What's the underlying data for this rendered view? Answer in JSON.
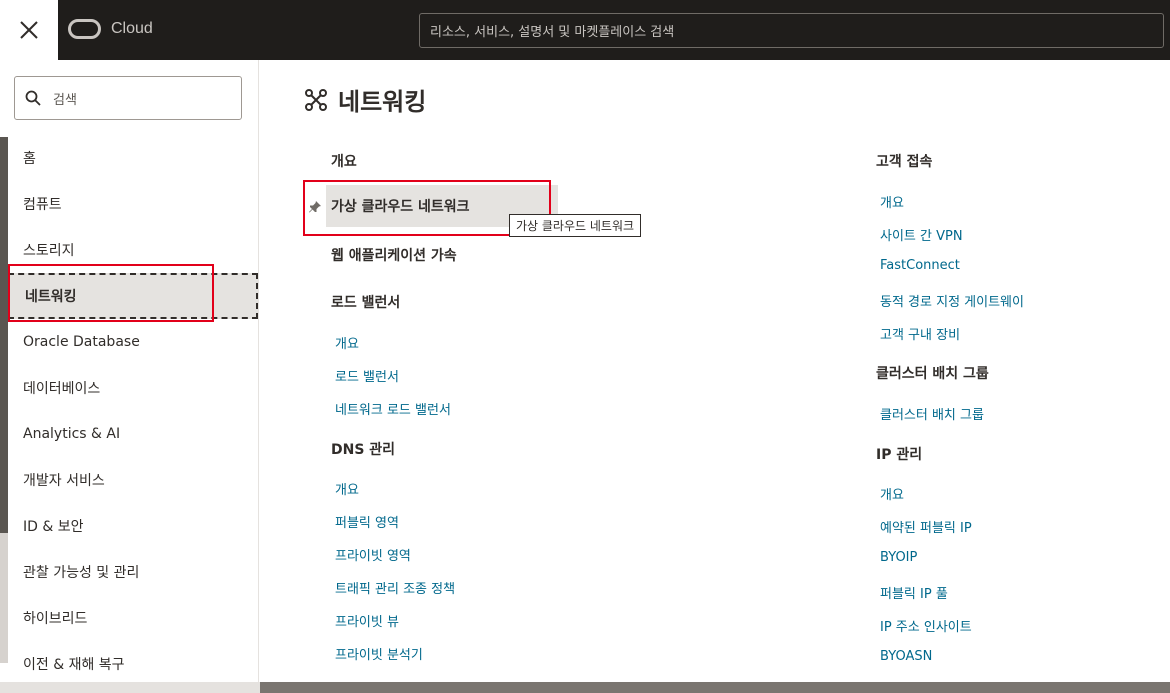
{
  "header": {
    "brand": "Cloud",
    "search_placeholder": "리소스, 서비스, 설명서 및 마켓플레이스 검색"
  },
  "sidebar": {
    "search_placeholder": "검색",
    "items": [
      {
        "label": "홈"
      },
      {
        "label": "컴퓨트"
      },
      {
        "label": "스토리지"
      },
      {
        "label": "네트워킹",
        "active": true
      },
      {
        "label": "Oracle Database"
      },
      {
        "label": "데이터베이스"
      },
      {
        "label": "Analytics & AI"
      },
      {
        "label": "개발자 서비스"
      },
      {
        "label": "ID & 보안"
      },
      {
        "label": "관찰 가능성 및 관리"
      },
      {
        "label": "하이브리드"
      },
      {
        "label": "이전 & 재해 복구"
      }
    ]
  },
  "main": {
    "title": "네트워킹",
    "left_column": {
      "overview": "개요",
      "vcn": "가상 클라우드 네트워크",
      "vcn_tooltip": "가상 클라우드 네트워크",
      "waa": "웹 애플리케이션 가속",
      "lb_header": "로드 밸런서",
      "lb_links": [
        "개요",
        "로드 밸런서",
        "네트워크 로드 밸런서"
      ],
      "dns_header": "DNS 관리",
      "dns_links": [
        "개요",
        "퍼블릭 영역",
        "프라이빗 영역",
        "트래픽 관리 조종 정책",
        "프라이빗 뷰",
        "프라이빗 분석기"
      ]
    },
    "right_column": {
      "cc_header": "고객 접속",
      "cc_links": [
        "개요",
        "사이트 간 VPN",
        "FastConnect",
        "동적 경로 지정 게이트웨이",
        "고객 구내 장비"
      ],
      "cpg_header": "클러스터 배치 그룹",
      "cpg_links": [
        "클러스터 배치 그룹"
      ],
      "ip_header": "IP 관리",
      "ip_links": [
        "개요",
        "예약된 퍼블릭 IP",
        "BYOIP",
        "퍼블릭 IP 풀",
        "IP 주소 인사이트",
        "BYOASN"
      ]
    }
  }
}
